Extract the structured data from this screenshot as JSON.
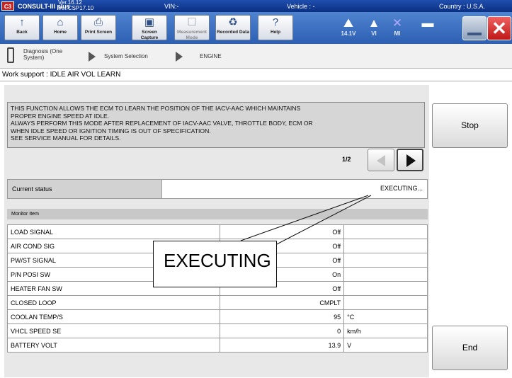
{
  "titlebar": {
    "logo": "C3",
    "app": "CONSULT-III plus",
    "version1": "Ver.16.12",
    "version2": "Ver.CSP17.10",
    "vin": "VIN:-",
    "vehicle": "Vehicle : -",
    "country": "Country : U.S.A."
  },
  "toolbar": {
    "back": "Back",
    "home": "Home",
    "print": "Print Screen",
    "capture": "Screen Capture",
    "measure": "Measurement Mode",
    "recorded": "Recorded Data",
    "help": "Help",
    "battery": "14.1V",
    "vi": "VI",
    "mi": "MI"
  },
  "breadcrumb": {
    "item1": "Diagnosis (One System)",
    "item2": "System Selection",
    "item3": "ENGINE"
  },
  "page_title": "Work support : IDLE AIR VOL LEARN",
  "message_lines": [
    "THIS FUNCTION ALLOWS THE ECM TO LEARN THE POSITION OF THE IACV-AAC WHICH MAINTAINS",
    "PROPER ENGINE SPEED AT IDLE.",
    "ALWAYS PERFORM THIS MODE AFTER REPLACEMENT OF IACV-AAC VALVE, THROTTLE BODY, ECM OR",
    "WHEN IDLE SPEED OR IGNITION TIMING IS OUT OF SPECIFICATION.",
    "SEE SERVICE MANUAL FOR DETAILS."
  ],
  "pager": "1/2",
  "status": {
    "label": "Current status",
    "value": "EXECUTING..."
  },
  "monitor_header": "Monitor Item",
  "monitor": [
    {
      "name": "LOAD SIGNAL",
      "value": "Off",
      "unit": ""
    },
    {
      "name": "AIR COND SIG",
      "value": "Off",
      "unit": ""
    },
    {
      "name": "PW/ST SIGNAL",
      "value": "Off",
      "unit": ""
    },
    {
      "name": "P/N POSI SW",
      "value": "On",
      "unit": ""
    },
    {
      "name": "HEATER FAN SW",
      "value": "Off",
      "unit": ""
    },
    {
      "name": "CLOSED LOOP",
      "value": "CMPLT",
      "unit": ""
    },
    {
      "name": "COOLAN TEMP/S",
      "value": "95",
      "unit": "°C"
    },
    {
      "name": "VHCL SPEED SE",
      "value": "0",
      "unit": "km/h"
    },
    {
      "name": "BATTERY VOLT",
      "value": "13.9",
      "unit": "V"
    }
  ],
  "buttons": {
    "stop": "Stop",
    "end": "End"
  },
  "callout": "EXECUTING"
}
